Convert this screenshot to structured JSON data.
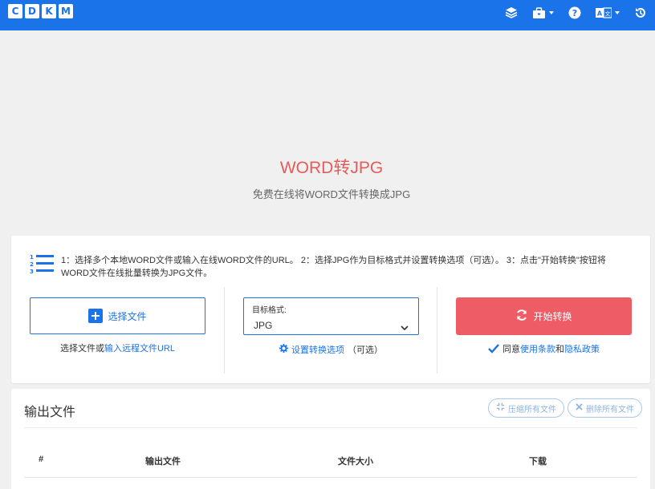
{
  "logo": [
    "C",
    "D",
    "K",
    "M"
  ],
  "header_icons": [
    "layers-icon",
    "toolbox-icon",
    "help-icon",
    "language-icon",
    "history-icon"
  ],
  "hero": {
    "title": "WORD转JPG",
    "subtitle": "免费在线将WORD文件转换成JPG"
  },
  "instructions": "1：选择多个本地WORD文件或输入在线WORD文件的URL。 2：选择JPG作为目标格式并设置转换选项（可选）。 3：点击\"开始转换\"按钮将WORD文件在线批量转换为JPG文件。",
  "upload": {
    "button_label": "选择文件",
    "help_prefix": "选择文件或",
    "help_link": "输入远程文件URL"
  },
  "format": {
    "label": "目标格式:",
    "value": "JPG",
    "settings_link": "设置转换选项",
    "settings_suffix": "（可选）"
  },
  "convert": {
    "button_label": "开始转换",
    "agree_prefix": "同意",
    "terms_link": "使用条款",
    "and": "和",
    "privacy_link": "隐私政策",
    "agreed": true
  },
  "output": {
    "title": "输出文件",
    "compress_all": "压缩所有文件",
    "delete_all": "删除所有文件",
    "columns": [
      "#",
      "输出文件",
      "文件大小",
      "下载"
    ]
  },
  "colors": {
    "brand_blue": "#1a73e8",
    "accent_red": "#ee5d65",
    "title_red": "#e35d5b"
  }
}
